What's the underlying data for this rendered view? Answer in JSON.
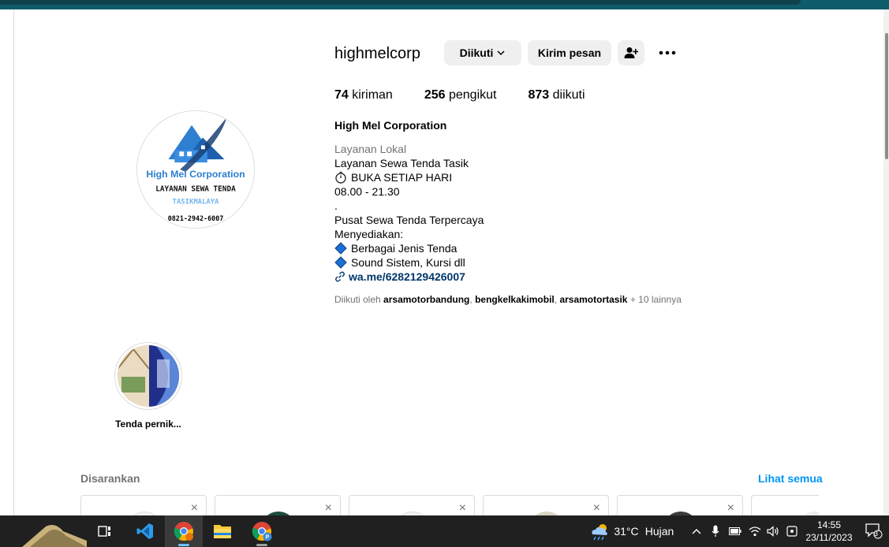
{
  "profile": {
    "username": "highmelcorp",
    "follow_button": "Diikuti",
    "message_button": "Kirim pesan",
    "stats": {
      "posts_count": "74",
      "posts_label": "kiriman",
      "followers_count": "256",
      "followers_label": "pengikut",
      "following_count": "873",
      "following_label": "diikuti"
    },
    "full_name": "High Mel Corporation",
    "category": "Layanan Lokal",
    "bio_lines": [
      "Layanan Sewa Tenda Tasik",
      "BUKA SETIAP HARI",
      "08.00 - 21.30",
      ".",
      "Pusat Sewa Tenda Terpercaya",
      "Menyediakan:",
      "Berbagai Jenis Tenda",
      "Sound Sistem, Kursi dll"
    ],
    "link": "wa.me/6282129426007",
    "followed_by": {
      "prefix": "Diikuti oleh",
      "user1": "arsamotorbandung",
      "user2": "bengkelkakimobil",
      "user3": "arsamotortasik",
      "more": "+ 10 lainnya"
    },
    "logo_text": {
      "line1": "High Mel Corporation",
      "line2": "LAYANAN SEWA TENDA",
      "line3": "TASIKMALAYA",
      "line4": "0821-2942-6007"
    }
  },
  "highlights": [
    {
      "label": "Tenda pernik..."
    }
  ],
  "suggested": {
    "title": "Disarankan",
    "see_all": "Lihat semua",
    "close_symbol": "×"
  },
  "taskbar": {
    "weather_temp": "31°C",
    "weather_desc": "Hujan",
    "time": "14:55",
    "date": "23/11/2023",
    "notification_count": "3"
  },
  "colors": {
    "link_blue": "#0095f6",
    "taskbar_bg": "#202020",
    "topbar": "#0e5b6a"
  }
}
